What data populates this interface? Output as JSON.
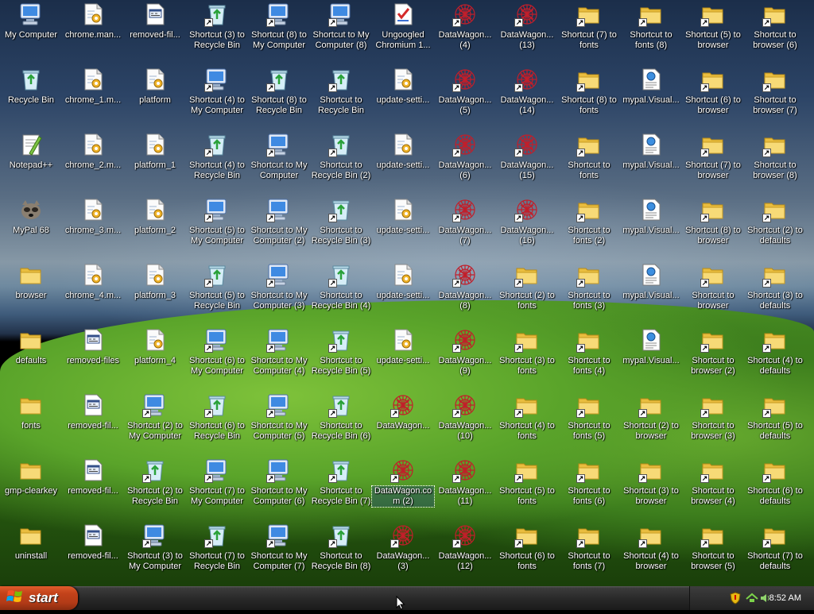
{
  "desktop": {
    "icons": [
      [
        "My Computer",
        "Recycle Bin",
        "Notepad++",
        "MyPal 68",
        "browser",
        "defaults",
        "fonts",
        "gmp-clearkey",
        "uninstall"
      ],
      [
        "chrome.man...",
        "chrome_1.m...",
        "chrome_2.m...",
        "chrome_3.m...",
        "chrome_4.m...",
        "removed-files",
        "removed-fil...",
        "removed-fil...",
        "removed-fil..."
      ],
      [
        "removed-fil...",
        "platform",
        "platform_1",
        "platform_2",
        "platform_3",
        "platform_4",
        "Shortcut (2) to My Computer",
        "Shortcut (2) to Recycle Bin",
        "Shortcut (3) to My Computer"
      ],
      [
        "Shortcut (3) to Recycle Bin",
        "Shortcut (4) to My Computer",
        "Shortcut (4) to Recycle Bin",
        "Shortcut (5) to My Computer",
        "Shortcut (5) to Recycle Bin",
        "Shortcut (6) to My Computer",
        "Shortcut (6) to Recycle Bin",
        "Shortcut (7) to My Computer",
        "Shortcut (7) to Recycle Bin"
      ],
      [
        "Shortcut (8) to My Computer",
        "Shortcut (8) to Recycle Bin",
        "Shortcut to My Computer",
        "Shortcut to My Computer (2)",
        "Shortcut to My Computer (3)",
        "Shortcut to My Computer (4)",
        "Shortcut to My Computer (5)",
        "Shortcut to My Computer (6)",
        "Shortcut to My Computer (7)"
      ],
      [
        "Shortcut to My Computer (8)",
        "Shortcut to Recycle Bin",
        "Shortcut to Recycle Bin (2)",
        "Shortcut to Recycle Bin (3)",
        "Shortcut to Recycle Bin (4)",
        "Shortcut to Recycle Bin (5)",
        "Shortcut to Recycle Bin (6)",
        "Shortcut to Recycle Bin (7)",
        "Shortcut to Recycle Bin (8)"
      ],
      [
        "Ungoogled Chromium 1...",
        "update-setti...",
        "update-setti...",
        "update-setti...",
        "update-setti...",
        "update-setti...",
        "DataWagon...",
        "DataWagon.com (2)",
        "DataWagon... (3)"
      ],
      [
        "DataWagon... (4)",
        "DataWagon... (5)",
        "DataWagon... (6)",
        "DataWagon... (7)",
        "DataWagon... (8)",
        "DataWagon... (9)",
        "DataWagon... (10)",
        "DataWagon... (11)",
        "DataWagon... (12)"
      ],
      [
        "DataWagon... (13)",
        "DataWagon... (14)",
        "DataWagon... (15)",
        "DataWagon... (16)",
        "Shortcut (2) to fonts",
        "Shortcut (3) to fonts",
        "Shortcut (4) to fonts",
        "Shortcut (5) to fonts",
        "Shortcut (6) to fonts"
      ],
      [
        "Shortcut (7) to fonts",
        "Shortcut (8) to fonts",
        "Shortcut to fonts",
        "Shortcut to fonts (2)",
        "Shortcut to fonts (3)",
        "Shortcut to fonts (4)",
        "Shortcut to fonts (5)",
        "Shortcut to fonts (6)",
        "Shortcut to fonts (7)"
      ],
      [
        "Shortcut to fonts (8)",
        "mypal.Visual...",
        "mypal.Visual...",
        "mypal.Visual...",
        "mypal.Visual...",
        "mypal.Visual...",
        "Shortcut (2) to browser",
        "Shortcut (3) to browser",
        "Shortcut (4) to browser"
      ],
      [
        "Shortcut (5) to browser",
        "Shortcut (6) to browser",
        "Shortcut (7) to browser",
        "Shortcut (8) to browser",
        "Shortcut to browser",
        "Shortcut to browser (2)",
        "Shortcut to browser (3)",
        "Shortcut to browser (4)",
        "Shortcut to browser (5)"
      ],
      [
        "Shortcut to browser (6)",
        "Shortcut to browser (7)",
        "Shortcut to browser (8)",
        "Shortcut (2) to defaults",
        "Shortcut (3) to defaults",
        "Shortcut (4) to defaults",
        "Shortcut (5) to defaults",
        "Shortcut (6) to defaults",
        "Shortcut (7) to defaults"
      ]
    ],
    "types": [
      [
        "computer",
        "recycle",
        "notepad",
        "mypal",
        "folder",
        "folder",
        "folder",
        "folder",
        "folder"
      ],
      [
        "cfg",
        "cfg",
        "cfg",
        "cfg",
        "cfg",
        "file",
        "file",
        "file",
        "file"
      ],
      [
        "file",
        "cfg",
        "cfg",
        "cfg",
        "cfg",
        "cfg",
        "computer",
        "recycle",
        "computer"
      ],
      [
        "recycle",
        "computer",
        "recycle",
        "computer",
        "recycle",
        "computer",
        "recycle",
        "computer",
        "recycle"
      ],
      [
        "computer",
        "recycle",
        "computer",
        "computer",
        "computer",
        "computer",
        "computer",
        "computer",
        "computer"
      ],
      [
        "computer",
        "recycle",
        "recycle",
        "recycle",
        "recycle",
        "recycle",
        "recycle",
        "recycle",
        "recycle"
      ],
      [
        "doc",
        "cfg",
        "cfg",
        "cfg",
        "cfg",
        "cfg",
        "web",
        "web",
        "web"
      ],
      [
        "web",
        "web",
        "web",
        "web",
        "web",
        "web",
        "web",
        "web",
        "web"
      ],
      [
        "web",
        "web",
        "web",
        "web",
        "folder",
        "folder",
        "folder",
        "folder",
        "folder"
      ],
      [
        "folder",
        "folder",
        "folder",
        "folder",
        "folder",
        "folder",
        "folder",
        "folder",
        "folder"
      ],
      [
        "folder",
        "vxml",
        "vxml",
        "vxml",
        "vxml",
        "vxml",
        "folder",
        "folder",
        "folder"
      ],
      [
        "folder",
        "folder",
        "folder",
        "folder",
        "folder",
        "folder",
        "folder",
        "folder",
        "folder"
      ],
      [
        "folder",
        "folder",
        "folder",
        "folder",
        "folder",
        "folder",
        "folder",
        "folder",
        "folder"
      ]
    ],
    "shortcuts": [
      [
        0,
        0,
        0,
        0,
        0,
        0,
        0,
        0,
        0
      ],
      [
        0,
        0,
        0,
        0,
        0,
        0,
        0,
        0,
        0
      ],
      [
        0,
        0,
        0,
        0,
        0,
        0,
        1,
        1,
        1
      ],
      [
        1,
        1,
        1,
        1,
        1,
        1,
        1,
        1,
        1
      ],
      [
        1,
        1,
        1,
        1,
        1,
        1,
        1,
        1,
        1
      ],
      [
        1,
        1,
        1,
        1,
        1,
        1,
        1,
        1,
        1
      ],
      [
        0,
        0,
        0,
        0,
        0,
        0,
        1,
        1,
        1
      ],
      [
        1,
        1,
        1,
        1,
        1,
        1,
        1,
        1,
        1
      ],
      [
        1,
        1,
        1,
        1,
        1,
        1,
        1,
        1,
        1
      ],
      [
        1,
        1,
        1,
        1,
        1,
        1,
        1,
        1,
        1
      ],
      [
        1,
        0,
        0,
        0,
        0,
        0,
        1,
        1,
        1
      ],
      [
        1,
        1,
        1,
        1,
        1,
        1,
        1,
        1,
        1
      ],
      [
        1,
        1,
        1,
        1,
        1,
        1,
        1,
        1,
        1
      ]
    ],
    "selected_label": "DataWagon.com (2)"
  },
  "taskbar": {
    "start_label": "start",
    "clock": "8:52 AM"
  },
  "colors": {
    "folder": "#f4d15c",
    "start": "#c3421a",
    "datawagon": "#c21e2a"
  }
}
